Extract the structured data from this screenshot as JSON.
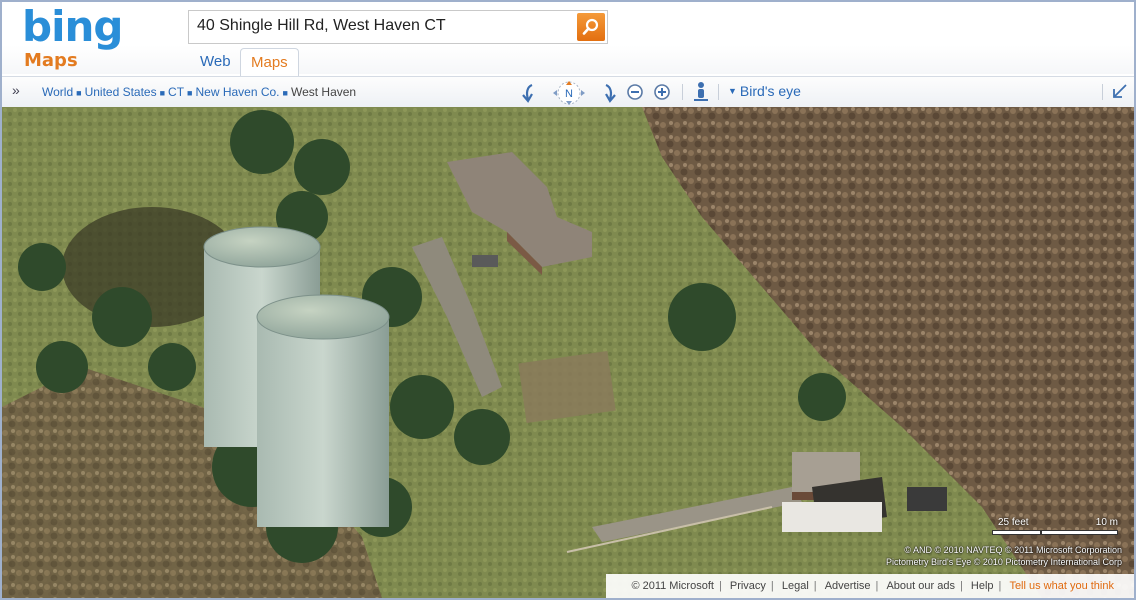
{
  "brand": {
    "logo": "bing",
    "product": "Maps"
  },
  "search": {
    "value": "40 Shingle Hill Rd, West Haven CT",
    "button_icon": "search-icon"
  },
  "tabs": [
    {
      "label": "Web",
      "active": false
    },
    {
      "label": "Maps",
      "active": true
    }
  ],
  "breadcrumb": {
    "items": [
      "World",
      "United States",
      "CT",
      "New Haven Co."
    ],
    "current": "West Haven"
  },
  "toolbar": {
    "compass_label": "N",
    "view_mode": "Bird's eye",
    "icons": [
      "rotate-left-icon",
      "compass-icon",
      "rotate-right-icon",
      "zoom-out-icon",
      "zoom-in-icon",
      "street-view-icon",
      "expand-icon"
    ]
  },
  "map": {
    "scale_left": "25 feet",
    "scale_right": "10 m",
    "copyright_line1": "© AND   © 2010 NAVTEQ   © 2011 Microsoft Corporation",
    "copyright_line2": "Pictometry Bird's Eye © 2010 Pictometry International Corp"
  },
  "footer": {
    "copyright": "© 2011 Microsoft",
    "links": [
      "Privacy",
      "Legal",
      "Advertise",
      "About our ads",
      "Help"
    ],
    "feedback": "Tell us what you think"
  },
  "colors": {
    "accent_orange": "#e37b20",
    "link_blue": "#2a6ab8",
    "logo_blue": "#2a8ed8"
  }
}
